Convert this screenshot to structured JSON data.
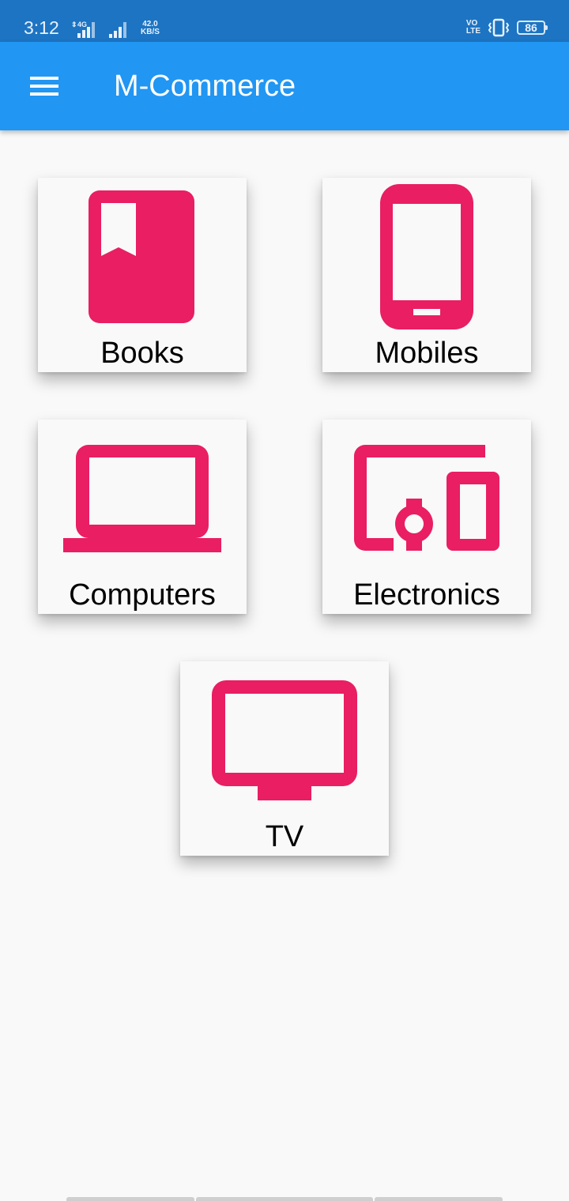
{
  "status_bar": {
    "time": "3:12",
    "network_type": "4G",
    "data_rate_value": "42.0",
    "data_rate_unit": "KB/S",
    "volte_top": "VO",
    "volte_bottom": "LTE",
    "battery": "86"
  },
  "app_bar": {
    "title": "M-Commerce",
    "menu_icon": "hamburger-menu-icon"
  },
  "categories": [
    {
      "label": "Books",
      "icon": "book-icon"
    },
    {
      "label": "Mobiles",
      "icon": "smartphone-icon"
    },
    {
      "label": "Computers",
      "icon": "laptop-icon"
    },
    {
      "label": "Electronics",
      "icon": "devices-icon"
    },
    {
      "label": "TV",
      "icon": "tv-icon"
    }
  ],
  "colors": {
    "status_bar": "#1d74c2",
    "app_bar": "#2196f3",
    "icon_accent": "#e91e63",
    "background": "#f9f9f9"
  }
}
